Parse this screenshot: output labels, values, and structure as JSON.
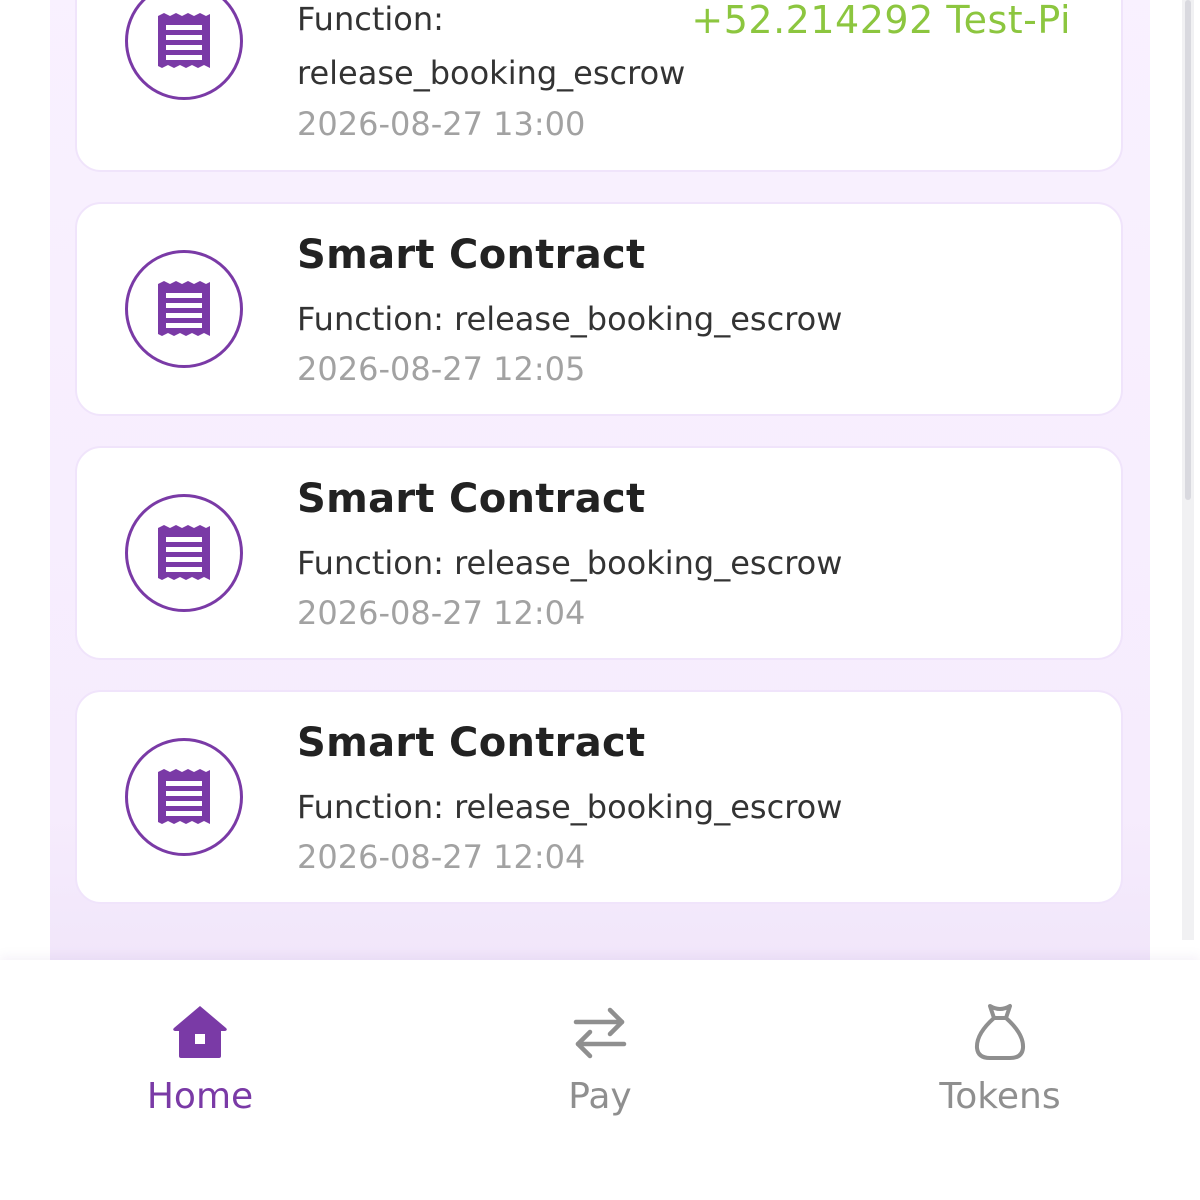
{
  "transactions": [
    {
      "function_line1": "Function:",
      "function_line2": "release_booking_escrow",
      "date": "2026-08-27 13:00",
      "amount": "+52.214292 Test-Pi",
      "icon": "receipt-icon"
    },
    {
      "title": "Smart Contract",
      "function": "Function: release_booking_escrow",
      "date": "2026-08-27 12:05",
      "icon": "receipt-icon"
    },
    {
      "title": "Smart Contract",
      "function": "Function: release_booking_escrow",
      "date": "2026-08-27 12:04",
      "icon": "receipt-icon"
    },
    {
      "title": "Smart Contract",
      "function": "Function: release_booking_escrow",
      "date": "2026-08-27 12:04",
      "icon": "receipt-icon"
    }
  ],
  "nav": {
    "items": [
      {
        "label": "Home",
        "icon": "home-icon",
        "active": true
      },
      {
        "label": "Pay",
        "icon": "swap-arrows-icon",
        "active": false
      },
      {
        "label": "Tokens",
        "icon": "money-bag-icon",
        "active": false
      }
    ]
  },
  "colors": {
    "accent": "#7a3aa6",
    "amount_positive": "#8cc63f",
    "muted_text": "#a2a2a2",
    "panel_bg": "#f8efff"
  }
}
